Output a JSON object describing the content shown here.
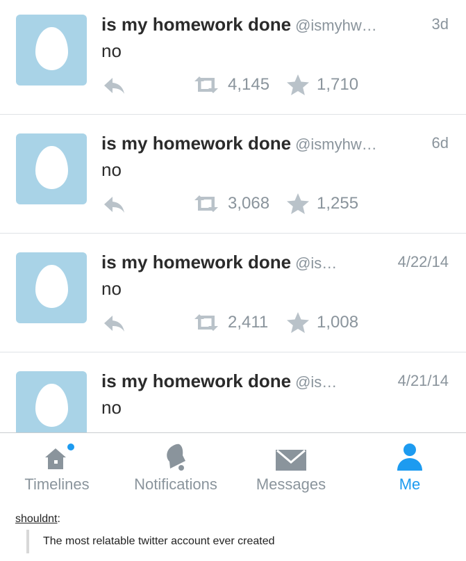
{
  "colors": {
    "avatar_bg": "#a9d3e7",
    "muted": "#8a949c",
    "active": "#1d9bf0",
    "text": "#2b2b2b"
  },
  "tweets": [
    {
      "name": "is my homework done",
      "handle": "@ismyhw…",
      "time": "3d",
      "text": "no",
      "retweets": "4,145",
      "favorites": "1,710"
    },
    {
      "name": "is my homework done",
      "handle": "@ismyhw…",
      "time": "6d",
      "text": "no",
      "retweets": "3,068",
      "favorites": "1,255"
    },
    {
      "name": "is my homework done",
      "handle": "@is…",
      "time": "4/22/14",
      "text": "no",
      "retweets": "2,411",
      "favorites": "1,008"
    },
    {
      "name": "is my homework done",
      "handle": "@is…",
      "time": "4/21/14",
      "text": "no",
      "retweets": "",
      "favorites": ""
    }
  ],
  "tabbar": {
    "timelines": "Timelines",
    "notifications": "Notifications",
    "messages": "Messages",
    "me": "Me"
  },
  "post": {
    "username": "shouldnt",
    "separator": ":",
    "quote": "The most relatable twitter account ever created"
  }
}
